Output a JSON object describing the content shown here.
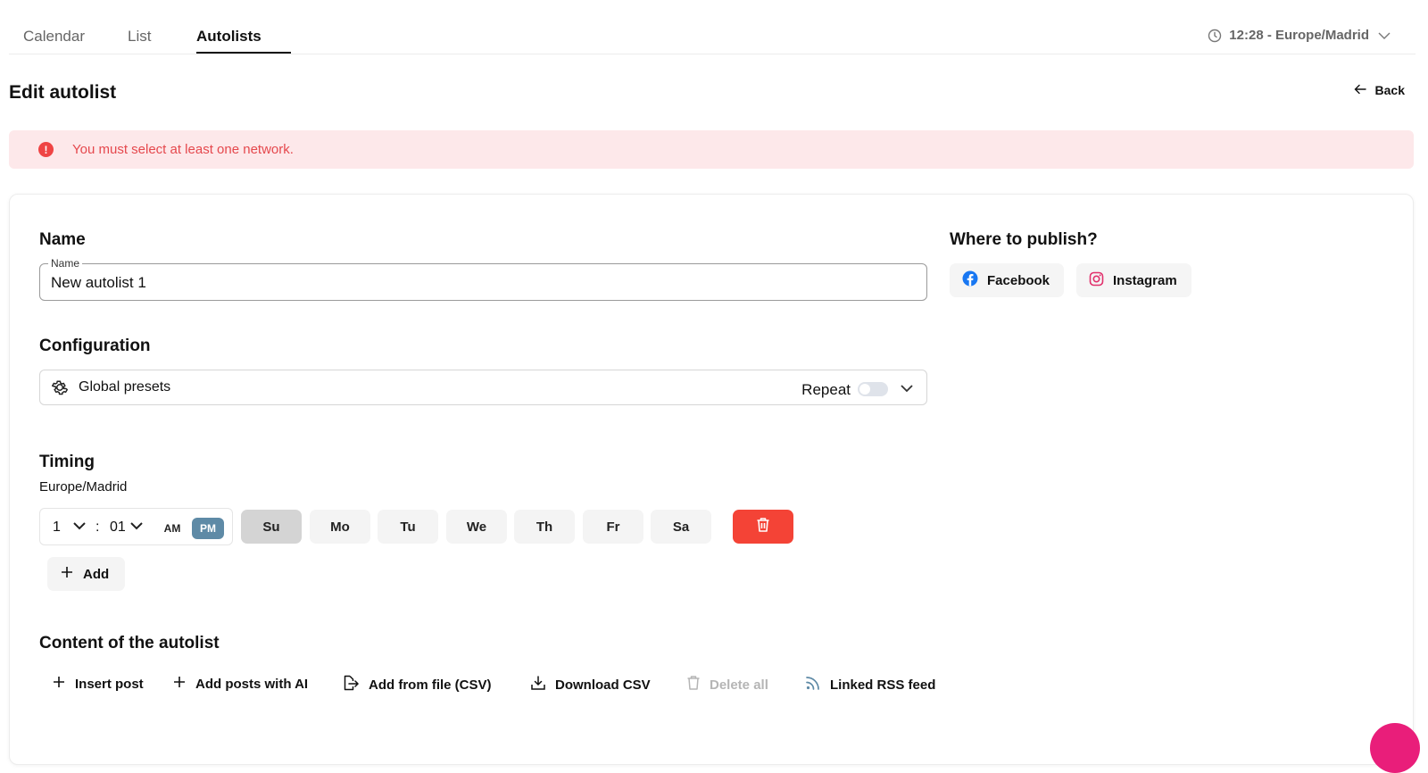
{
  "tabs": [
    {
      "label": "Calendar"
    },
    {
      "label": "List"
    },
    {
      "label": "Autolists",
      "active": true
    }
  ],
  "timezone_display": "12:28 - Europe/Madrid",
  "page_title": "Edit autolist",
  "back_label": "Back",
  "alert": {
    "message": "You must select at least one network.",
    "color": "#e5484d"
  },
  "name_section": {
    "title": "Name",
    "field_label": "Name",
    "value": "New autolist 1"
  },
  "publish": {
    "title": "Where to publish?",
    "networks": [
      {
        "label": "Facebook",
        "icon": "facebook-icon"
      },
      {
        "label": "Instagram",
        "icon": "instagram-icon"
      }
    ]
  },
  "configuration": {
    "title": "Configuration",
    "preset_label": "Global presets",
    "repeat_label": "Repeat",
    "repeat_on": false
  },
  "timing": {
    "title": "Timing",
    "timezone": "Europe/Madrid",
    "hour": "1",
    "separator": ":",
    "minute": "01",
    "am_label": "AM",
    "pm_label": "PM",
    "selected_period": "PM",
    "days": [
      {
        "label": "Su",
        "selected": true
      },
      {
        "label": "Mo",
        "selected": false
      },
      {
        "label": "Tu",
        "selected": false
      },
      {
        "label": "We",
        "selected": false
      },
      {
        "label": "Th",
        "selected": false
      },
      {
        "label": "Fr",
        "selected": false
      },
      {
        "label": "Sa",
        "selected": false
      }
    ],
    "add_label": "Add"
  },
  "content": {
    "title": "Content of the autolist",
    "actions": [
      {
        "label": "Insert post",
        "icon": "plus-icon",
        "enabled": true
      },
      {
        "label": "Add posts with AI",
        "icon": "plus-icon",
        "enabled": true
      },
      {
        "label": "Add from file (CSV)",
        "icon": "file-import-icon",
        "enabled": true
      },
      {
        "label": "Download CSV",
        "icon": "download-icon",
        "enabled": true
      },
      {
        "label": "Delete all",
        "icon": "trash-icon",
        "enabled": false
      },
      {
        "label": "Linked RSS feed",
        "icon": "rss-icon",
        "enabled": true
      }
    ]
  },
  "colors": {
    "accent_pm": "#5e8aa6",
    "delete": "#f44336",
    "alert_bg": "#fde8ea",
    "facebook": "#1877f2",
    "instagram": "#e1306c",
    "fab": "#e91e7a"
  }
}
